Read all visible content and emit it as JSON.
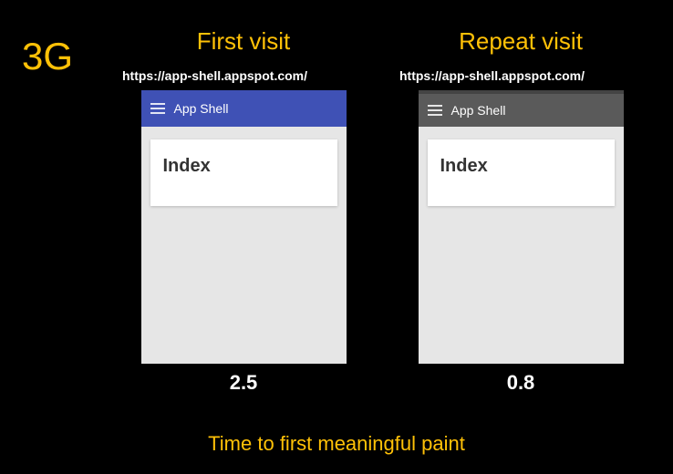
{
  "badge": "3G",
  "caption": "Time to first meaningful paint",
  "columns": {
    "first": {
      "title": "First visit",
      "url": "https://app-shell.appspot.com/",
      "appbar_title": "App Shell",
      "card_heading": "Index",
      "timing": "2.5"
    },
    "repeat": {
      "title": "Repeat visit",
      "url": "https://app-shell.appspot.com/",
      "appbar_title": "App Shell",
      "card_heading": "Index",
      "timing": "0.8"
    }
  }
}
